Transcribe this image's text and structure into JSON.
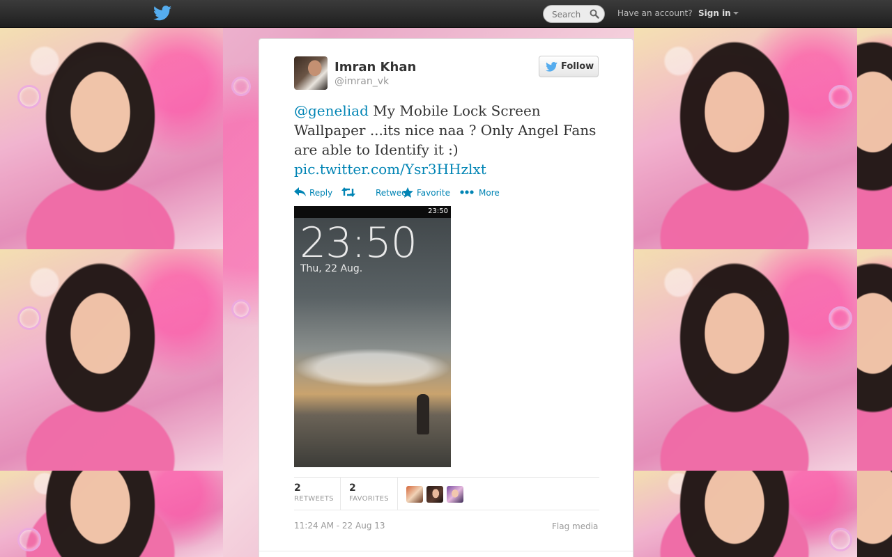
{
  "topbar": {
    "search_placeholder": "Search",
    "account_prompt": "Have an account?",
    "signin_label": "Sign in"
  },
  "tweet": {
    "author_name": "Imran Khan",
    "author_handle": "@imran_vk",
    "follow_label": "Follow",
    "mention": "@geneliad",
    "text": " My Mobile Lock Screen Wallpaper ...its nice naa ? Only Angel Fans are able to Identify it :)",
    "link": "pic.twitter.com/Ysr3HHzlxt",
    "actions": {
      "reply": "Reply",
      "retweet": "Retweet",
      "favorite": "Favorite",
      "more": "More"
    },
    "photo": {
      "status_time": "23:50",
      "clock": "23:50",
      "date": "Thu, 22 Aug."
    },
    "stats": {
      "retweets_count": "2",
      "retweets_label": "RETWEETS",
      "favorites_count": "2",
      "favorites_label": "FAVORITES"
    },
    "timestamp": "11:24 AM - 22 Aug 13",
    "flag_label": "Flag media"
  },
  "colors": {
    "link": "#0084b4",
    "topbar": "#2a2a2a",
    "twitter_blue": "#55acee"
  },
  "icons": [
    "twitter-bird-icon",
    "search-icon",
    "reply-icon",
    "retweet-icon",
    "star-icon",
    "more-icon"
  ]
}
